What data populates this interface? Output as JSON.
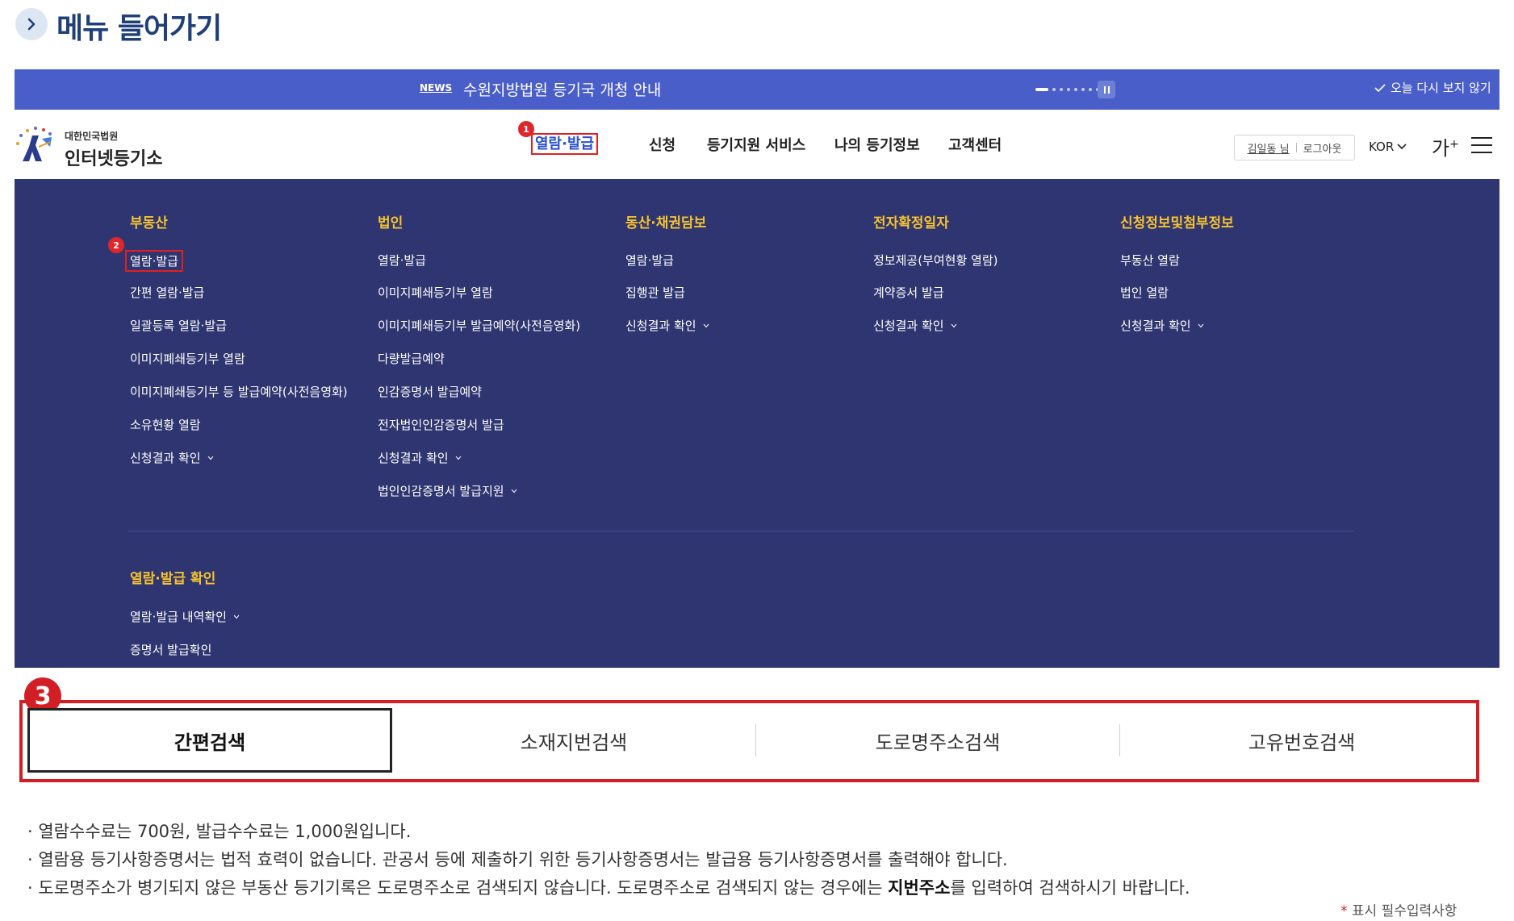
{
  "section_title": "메뉴 들어가기",
  "news": {
    "tag": "NEWS",
    "text": "수원지방법원 등기국 개청 안내",
    "dismiss": "오늘 다시 보지 않기"
  },
  "header": {
    "logo_small": "대한민국법원",
    "logo_big": "인터넷등기소",
    "gnb": [
      "열람·발급",
      "신청",
      "등기지원 서비스",
      "나의 등기정보",
      "고객센터"
    ],
    "user_name": "김일동 님",
    "logout": "로그아웃",
    "language": "KOR",
    "font_size": "가"
  },
  "markers": {
    "m1": "1",
    "m2": "2",
    "m3": "3"
  },
  "mega_menu": {
    "columns": [
      {
        "heading": "부동산",
        "items": [
          "열람·발급",
          "간편 열람·발급",
          "일괄등록 열람·발급",
          "이미지폐쇄등기부 열람",
          "이미지폐쇄등기부 등 발급예약(사전음영화)",
          "소유현황 열람",
          "신청결과 확인"
        ]
      },
      {
        "heading": "법인",
        "items": [
          "열람·발급",
          "이미지폐쇄등기부 열람",
          "이미지폐쇄등기부 발급예약(사전음영화)",
          "다량발급예약",
          "인감증명서 발급예약",
          "전자법인인감증명서 발급",
          "신청결과 확인",
          "법인인감증명서 발급지원"
        ]
      },
      {
        "heading": "동산·채권담보",
        "items": [
          "열람·발급",
          "집행관 발급",
          "신청결과 확인"
        ]
      },
      {
        "heading": "전자확정일자",
        "items": [
          "정보제공(부여현황 열람)",
          "계약증서 발급",
          "신청결과 확인"
        ]
      },
      {
        "heading": "신청정보및첨부정보",
        "items": [
          "부동산 열람",
          "법인 열람",
          "신청결과 확인"
        ]
      }
    ],
    "bottom": {
      "heading": "열람·발급 확인",
      "items": [
        "열람·발급 내역확인",
        "증명서 발급확인"
      ]
    }
  },
  "tabs": [
    "간편검색",
    "소재지번검색",
    "도로명주소검색",
    "고유번호검색"
  ],
  "notes": {
    "n1": "열람수수료는  700원, 발급수수료는  1,000원입니다.",
    "n2": "열람용 등기사항증명서는 법적 효력이 없습니다. 관공서 등에 제출하기 위한 등기사항증명서는 발급용 등기사항증명서를 출력해야 합니다.",
    "n3_before": "도로명주소가 병기되지 않은 부동산 등기기록은 도로명주소로 검색되지 않습니다. 도로명주소로 검색되지 않는 경우에는 ",
    "n3_bold": "지번주소",
    "n3_after": "를 입력하여 검색하시기 바랍니다."
  },
  "required_note": "표시 필수입력사항",
  "colors": {
    "newsbar": "#4a5ec9",
    "mega_bg": "#2e3570",
    "heading_gold": "#f5c330",
    "highlight_red": "#d21f25",
    "title_navy": "#1f3f78"
  }
}
